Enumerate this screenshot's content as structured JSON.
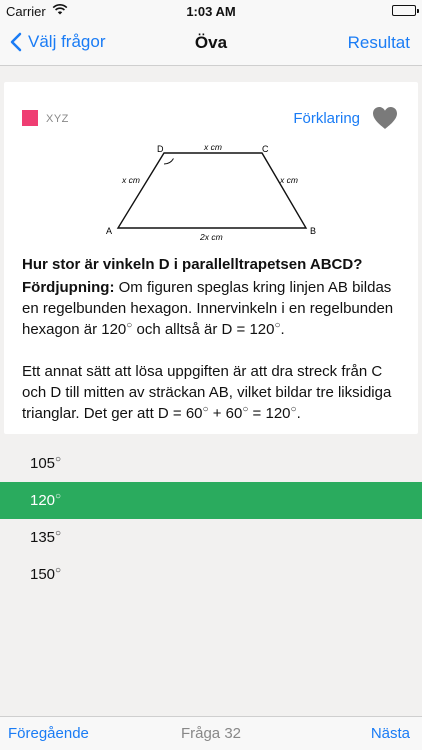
{
  "status": {
    "carrier": "Carrier",
    "time": "1:03 AM"
  },
  "nav": {
    "back_label": "Välj frågor",
    "title": "Öva",
    "right_label": "Resultat"
  },
  "card": {
    "tag_color": "#ef3e73",
    "tag_label": "XYZ",
    "explain_label": "Förklaring",
    "figure": {
      "vertex_a": "A",
      "vertex_b": "B",
      "vertex_c": "C",
      "vertex_d": "D",
      "top_side": "x cm",
      "left_side": "x cm",
      "right_side": "x cm",
      "bottom_side": "2x cm"
    },
    "question": "Hur stor är vinkeln D i parallelltrapetsen ABCD?",
    "explanation": {
      "heading": "Fördjupning:",
      "p1_text": " Om figuren speglas kring linjen AB bildas en regelbunden hexagon. Innervinkeln i en regelbunden hexagon är 120",
      "p1_mid": " och alltså är D = 120",
      "p1_end": ".",
      "p2_text": "Ett annat sätt att lösa uppgiften är att dra streck från C och D till mitten av sträckan AB, vilket bildar tre liksidiga trianglar. Det ger att D = 60",
      "p2_mid": " + 60",
      "p2_mid2": " = 120",
      "p2_end": "."
    }
  },
  "degree_symbol": "○",
  "answers": [
    {
      "label": "105",
      "selected": false
    },
    {
      "label": "120",
      "selected": true
    },
    {
      "label": "135",
      "selected": false
    },
    {
      "label": "150",
      "selected": false
    }
  ],
  "bottom": {
    "prev_label": "Föregående",
    "question_number": "Fråga 32",
    "next_label": "Nästa"
  },
  "colors": {
    "accent": "#1a7cf5",
    "correct": "#2aab5e",
    "tag": "#ef3e73"
  }
}
